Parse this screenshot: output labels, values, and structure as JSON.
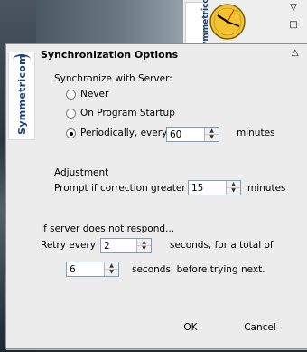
{
  "widget": {
    "logo_text": "Symmetricom",
    "dropdown_glyph": "▽",
    "square_glyph": "□"
  },
  "dialog": {
    "title": "Synchronization Options",
    "collapse_glyph": "△",
    "logo_text": "Symmetricom"
  },
  "sync": {
    "section_label": "Synchronize with Server:",
    "options": [
      {
        "label": "Never",
        "selected": false
      },
      {
        "label": "On Program Startup",
        "selected": false
      },
      {
        "label": "Periodically, every",
        "selected": true
      }
    ],
    "period_value": "60",
    "period_unit": "minutes"
  },
  "adjustment": {
    "section_label": "Adjustment",
    "prompt_label": "Prompt if correction greater",
    "value": "15",
    "unit": "minutes"
  },
  "retry": {
    "section_label": "If server does not respond...",
    "retry_label": "Retry every",
    "retry_value": "2",
    "retry_unit": "seconds, for a total of",
    "total_value": "6",
    "total_unit": "seconds, before trying next."
  },
  "buttons": {
    "ok": "OK",
    "cancel": "Cancel"
  },
  "spin_glyphs": {
    "up": "▲",
    "down": "▼"
  },
  "colors": {
    "dialog_bg": "#ececec",
    "logo_blue": "#1f3f7a",
    "clock_face": "#f2c230"
  }
}
